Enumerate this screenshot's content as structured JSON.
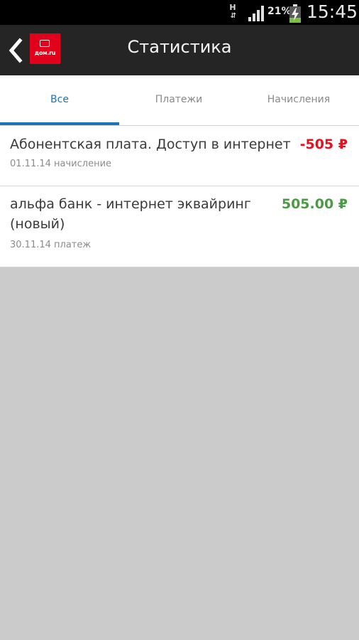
{
  "status_bar": {
    "network_type": "H",
    "network_arrows": "⇵",
    "battery_percent": "21%",
    "time": "15:45"
  },
  "app_bar": {
    "back_icon": "chevron-left-icon",
    "logo_text": "дом.ru",
    "title": "Статистика"
  },
  "tabs": [
    {
      "label": "Все",
      "active": true
    },
    {
      "label": "Платежи",
      "active": false
    },
    {
      "label": "Начисления",
      "active": false
    }
  ],
  "transactions": [
    {
      "title": "Абонентская плата. Доступ в интернет",
      "amount": "-505 ₽",
      "date": "01.11.14",
      "type": "начисление",
      "meta": "01.11.14 начисление",
      "amount_color": "#e8101c"
    },
    {
      "title_line1": "альфа банк - интернет эквайринг",
      "title_line2": "(новый)",
      "amount": "505.00 ₽",
      "date": "30.11.14",
      "type": "платеж",
      "meta": "30.11.14 платеж",
      "amount_color": "#4b9b45"
    }
  ],
  "colors": {
    "app_bar": "#252525",
    "accent": "#1d74b9",
    "logo": "#e3001b",
    "empty_area": "#cbcbcb"
  }
}
